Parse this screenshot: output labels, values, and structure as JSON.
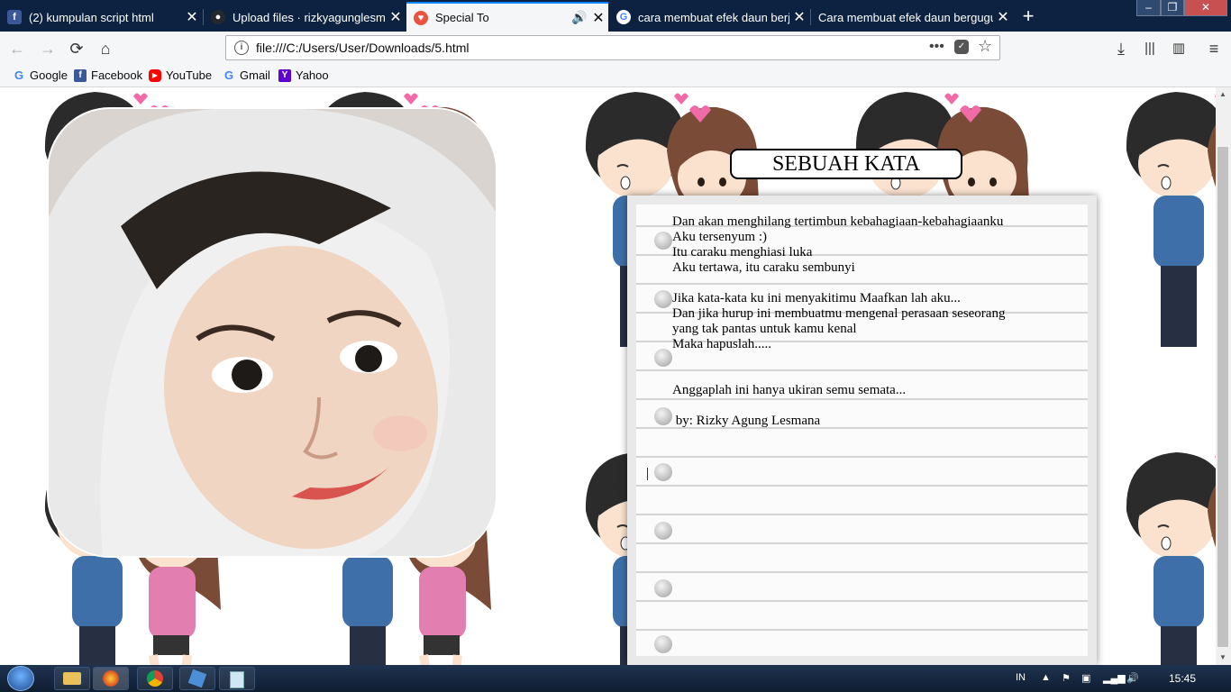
{
  "browser": {
    "tabs": [
      {
        "title": "(2) kumpulan script html",
        "favicon": "facebook-icon",
        "active": false
      },
      {
        "title": "Upload files · rizkyagunglesmana",
        "favicon": "github-icon",
        "active": false
      },
      {
        "title": "Special To",
        "favicon": "heart-icon",
        "active": true,
        "audio": true
      },
      {
        "title": "cara membuat efek daun berjatuhan",
        "favicon": "google-icon",
        "active": false
      },
      {
        "title": "Cara membuat efek daun berguguran",
        "favicon": "blogger-icon",
        "active": false
      }
    ],
    "url": "file:///C:/Users/User/Downloads/5.html",
    "bookmarks": [
      {
        "label": "Google",
        "icon": "google-icon"
      },
      {
        "label": "Facebook",
        "icon": "facebook-icon"
      },
      {
        "label": "YouTube",
        "icon": "youtube-icon"
      },
      {
        "label": "Gmail",
        "icon": "google-icon"
      },
      {
        "label": "Yahoo",
        "icon": "yahoo-icon"
      }
    ]
  },
  "page": {
    "title": "SEBUAH KATA",
    "poem_lines": [
      "Dan akan menghilang tertimbun kebahagiaan-kebahagiaanku",
      "Aku tersenyum :)",
      "Itu caraku menghiasi luka",
      "Aku tertawa, itu caraku sembunyi",
      "",
      "Jika kata-kata ku ini menyakitimu Maafkan lah aku...",
      "Dan jika hurup ini membuatmu mengenal perasaan seseorang",
      "yang tak pantas untuk kamu kenal",
      "Maka hapuslah.....",
      "",
      "",
      "Anggaplah ini hanya ukiran semu semata...",
      "",
      " by: Rizky Agung Lesmana"
    ]
  },
  "taskbar": {
    "language": "IN",
    "clock": "15:45",
    "apps": [
      "explorer-icon",
      "firefox-icon",
      "chrome-icon",
      "virtualbox-icon",
      "notepad-icon"
    ]
  },
  "colors": {
    "tabbar": "#0c2240",
    "accent": "#0a84ff",
    "facebook": "#3b5998",
    "youtube": "#ff0000",
    "yahoo": "#5f01d1"
  }
}
